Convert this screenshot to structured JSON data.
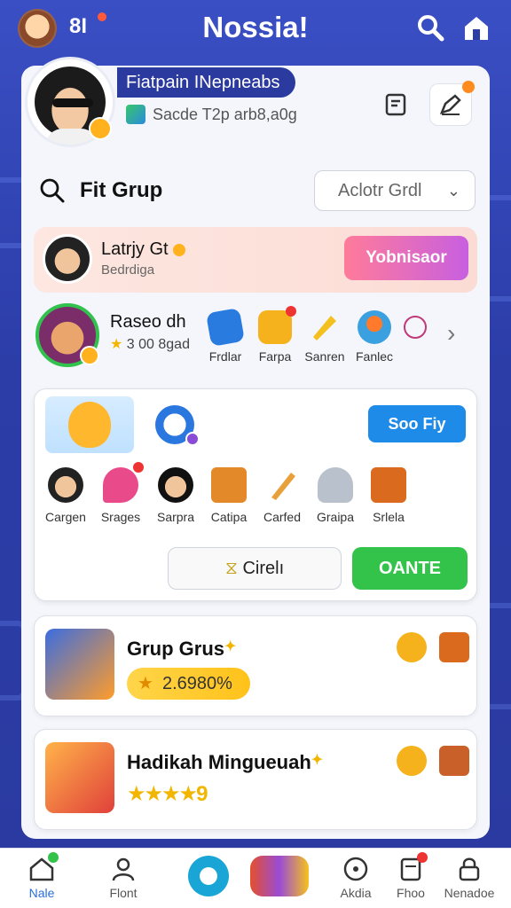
{
  "topbar": {
    "count": "8I",
    "title": "Nossia!"
  },
  "profile": {
    "name": "Fiatpain INepneabs",
    "status": "Sacde T2p arb8,a0g"
  },
  "search": {
    "label": "Fit Grup",
    "select_value": "Aclotr Grdl"
  },
  "featured_user": {
    "name": "Latrjy Gt",
    "subtitle": "Bedrdiga",
    "button": "Yobnisaor"
  },
  "features": {
    "user_name": "Raseo dh",
    "score": "3 00 8gad",
    "items": [
      {
        "label": "Frdlar"
      },
      {
        "label": "Farpa"
      },
      {
        "label": "Sanren"
      },
      {
        "label": "Fanlec"
      }
    ]
  },
  "panel": {
    "blue_button": "Soo Fiy",
    "items": [
      {
        "label": "Cargen"
      },
      {
        "label": "Srages"
      },
      {
        "label": "Sarpra"
      },
      {
        "label": "Catipa"
      },
      {
        "label": "Carfed"
      },
      {
        "label": "Graipa"
      },
      {
        "label": "Srlela"
      }
    ],
    "outline_button": "Cirelı",
    "green_button": "OANTE"
  },
  "groups": [
    {
      "title": "Grup Grus",
      "pill": "2.6980%"
    },
    {
      "title": "Hadikah Mingueuah",
      "rating_number": "9"
    }
  ],
  "nav": [
    {
      "label": "Nale"
    },
    {
      "label": "Flont"
    },
    {
      "label": ""
    },
    {
      "label": ""
    },
    {
      "label": "Akdia"
    },
    {
      "label": "Fhoo"
    },
    {
      "label": "Nenadoe"
    }
  ],
  "colors": {
    "primary_blue": "#2b3a9e",
    "accent_green": "#33c24a",
    "accent_pink": "#ff7b9a"
  }
}
